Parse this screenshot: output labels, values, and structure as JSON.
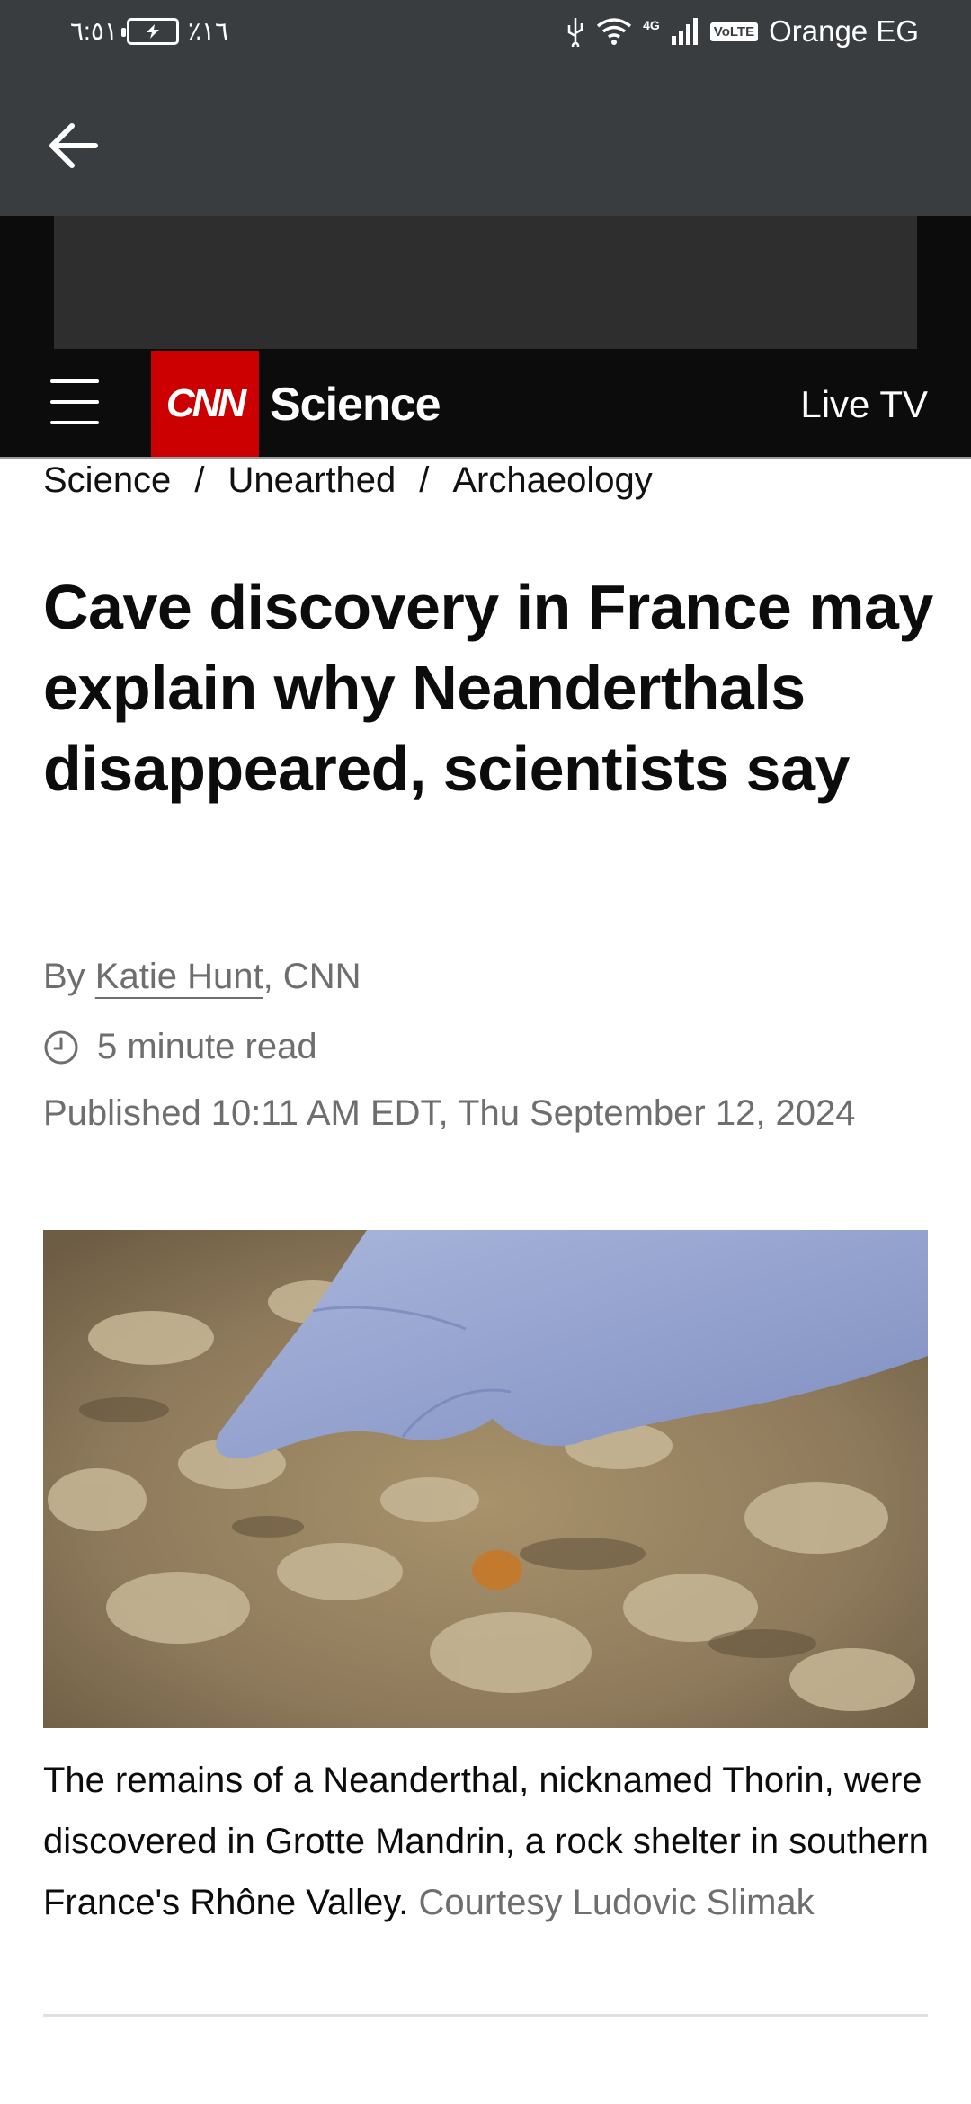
{
  "status_bar": {
    "time": "٦:٥١",
    "battery_percent": "٪١٦",
    "network": "4G",
    "volte": "VoLTE",
    "carrier": "Orange EG"
  },
  "header": {
    "brand": "CNN",
    "section": "Science",
    "live_tv": "Live TV",
    "brand_color": "#cc0000"
  },
  "breadcrumb": [
    "Science",
    "Unearthed",
    "Archaeology"
  ],
  "article": {
    "headline": "Cave discovery in France may explain why Neanderthals disappeared, scientists say",
    "byline_prefix": "By ",
    "author": "Katie Hunt",
    "byline_suffix": ", CNN",
    "read_time": "5 minute read",
    "published": "Published 10:11 AM EDT, Thu September 12, 2024",
    "caption": "The remains of a Neanderthal, nicknamed Thorin, were discovered in Grotte Mandrin, a rock shelter in southern France's Rhône Valley.",
    "credit": "Courtesy Ludovic Slimak"
  }
}
